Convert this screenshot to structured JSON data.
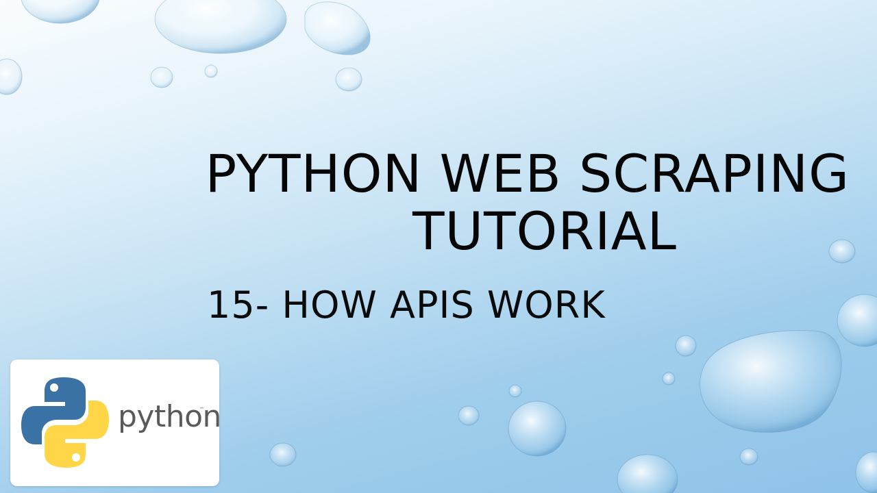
{
  "slide": {
    "title_line1": "PYTHON WEB SCRAPING",
    "title_line2": "TUTORIAL",
    "subtitle": "15- HOW APIS WORK"
  },
  "logo": {
    "wordmark": "python",
    "trademark": "™",
    "colors": {
      "blue": "#3b72a6",
      "yellow": "#ffd648"
    }
  },
  "theme": {
    "background_top": "#fafdff",
    "background_bottom": "#8fc3e8",
    "text_color": "#050505"
  }
}
